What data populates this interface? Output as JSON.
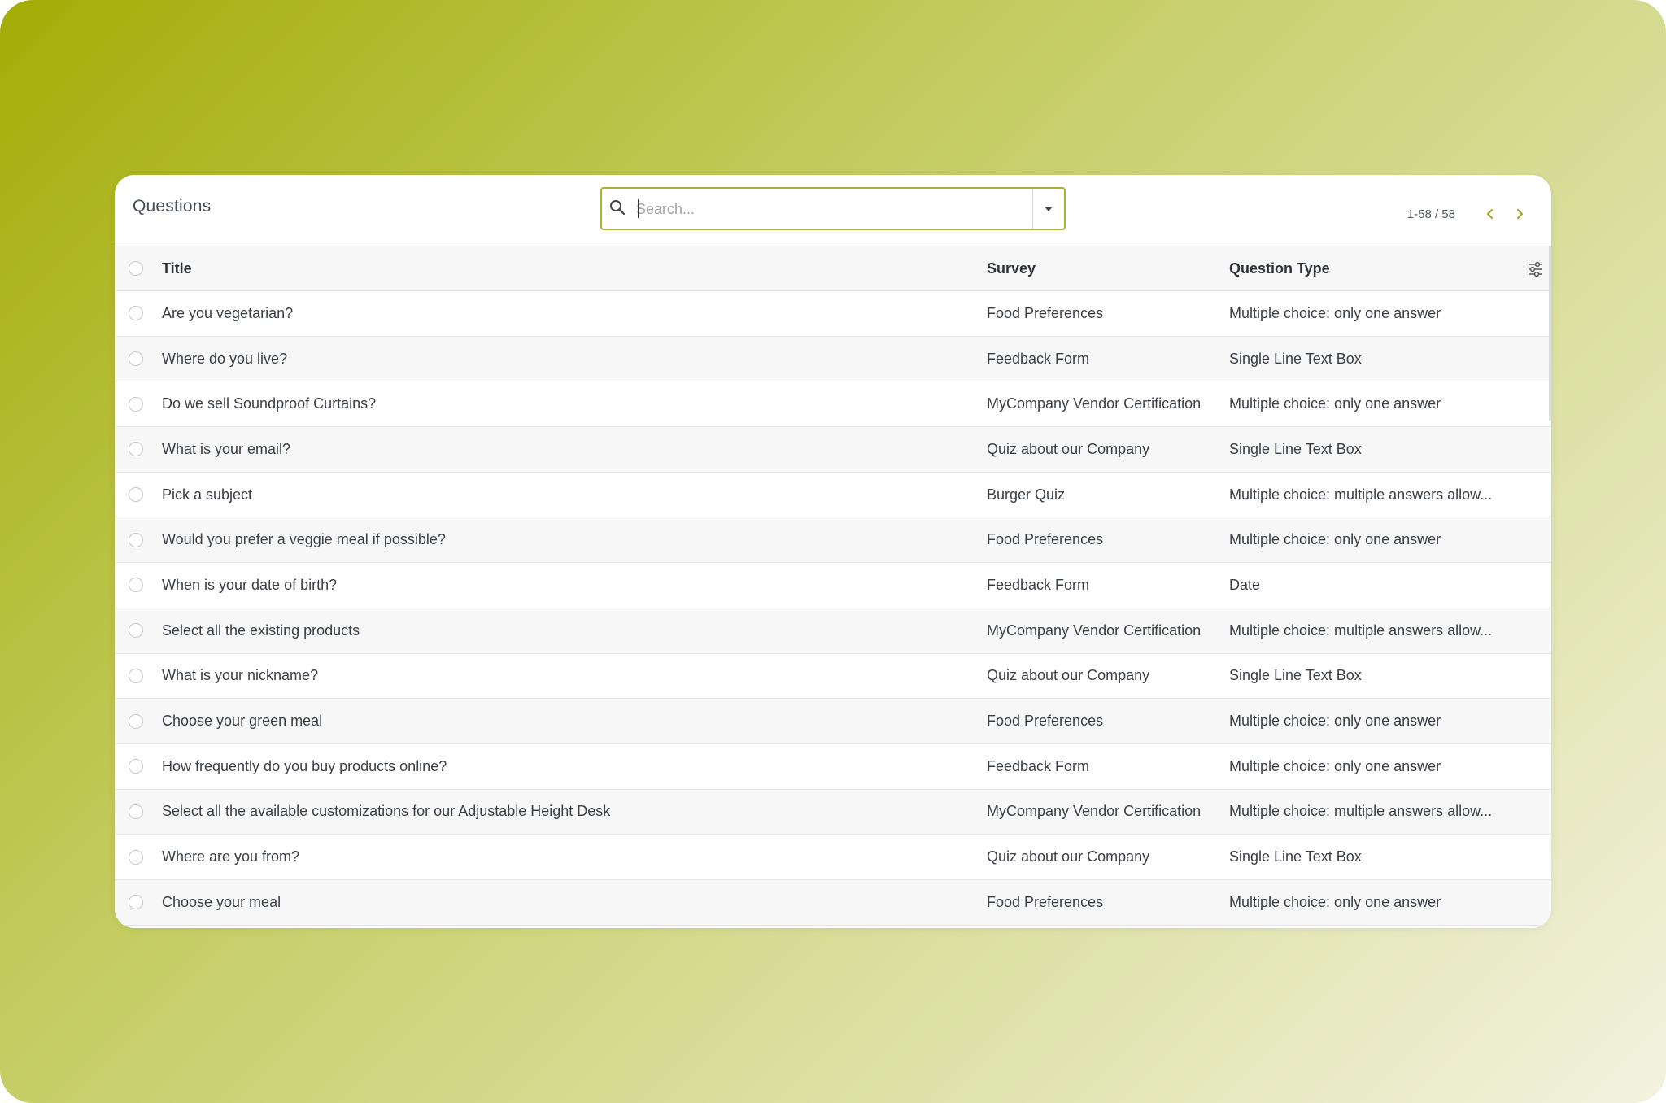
{
  "page": {
    "title": "Questions",
    "search_placeholder": "Search...",
    "pager": "1-58 / 58"
  },
  "colors": {
    "accent": "#a9b33a",
    "pager_arrow": "#9aa420",
    "background_start": "#a3ad06",
    "background_end": "#f3f2df"
  },
  "icons": {
    "search": "search-icon",
    "dropdown": "caret-down-icon",
    "prev": "chevron-left-icon",
    "next": "chevron-right-icon",
    "column_settings": "sliders-icon"
  },
  "table": {
    "columns": [
      "Title",
      "Survey",
      "Question Type"
    ],
    "rows": [
      {
        "title": "Are you vegetarian?",
        "survey": "Food Preferences",
        "type": "Multiple choice: only one answer"
      },
      {
        "title": "Where do you live?",
        "survey": "Feedback Form",
        "type": "Single Line Text Box"
      },
      {
        "title": "Do we sell Soundproof Curtains?",
        "survey": "MyCompany Vendor Certification",
        "type": "Multiple choice: only one answer"
      },
      {
        "title": "What is your email?",
        "survey": "Quiz about our Company",
        "type": "Single Line Text Box"
      },
      {
        "title": "Pick a subject",
        "survey": "Burger Quiz",
        "type": "Multiple choice: multiple answers allow..."
      },
      {
        "title": "Would you prefer a veggie meal if possible?",
        "survey": "Food Preferences",
        "type": "Multiple choice: only one answer"
      },
      {
        "title": "When is your date of birth?",
        "survey": "Feedback Form",
        "type": "Date"
      },
      {
        "title": "Select all the existing products",
        "survey": "MyCompany Vendor Certification",
        "type": "Multiple choice: multiple answers allow..."
      },
      {
        "title": "What is your nickname?",
        "survey": "Quiz about our Company",
        "type": "Single Line Text Box"
      },
      {
        "title": "Choose your green meal",
        "survey": "Food Preferences",
        "type": "Multiple choice: only one answer"
      },
      {
        "title": "How frequently do you buy products online?",
        "survey": "Feedback Form",
        "type": "Multiple choice: only one answer"
      },
      {
        "title": "Select all the available customizations for our Adjustable Height Desk",
        "survey": "MyCompany Vendor Certification",
        "type": "Multiple choice: multiple answers allow..."
      },
      {
        "title": "Where are you from?",
        "survey": "Quiz about our Company",
        "type": "Single Line Text Box"
      },
      {
        "title": "Choose your meal",
        "survey": "Food Preferences",
        "type": "Multiple choice: only one answer"
      }
    ]
  }
}
